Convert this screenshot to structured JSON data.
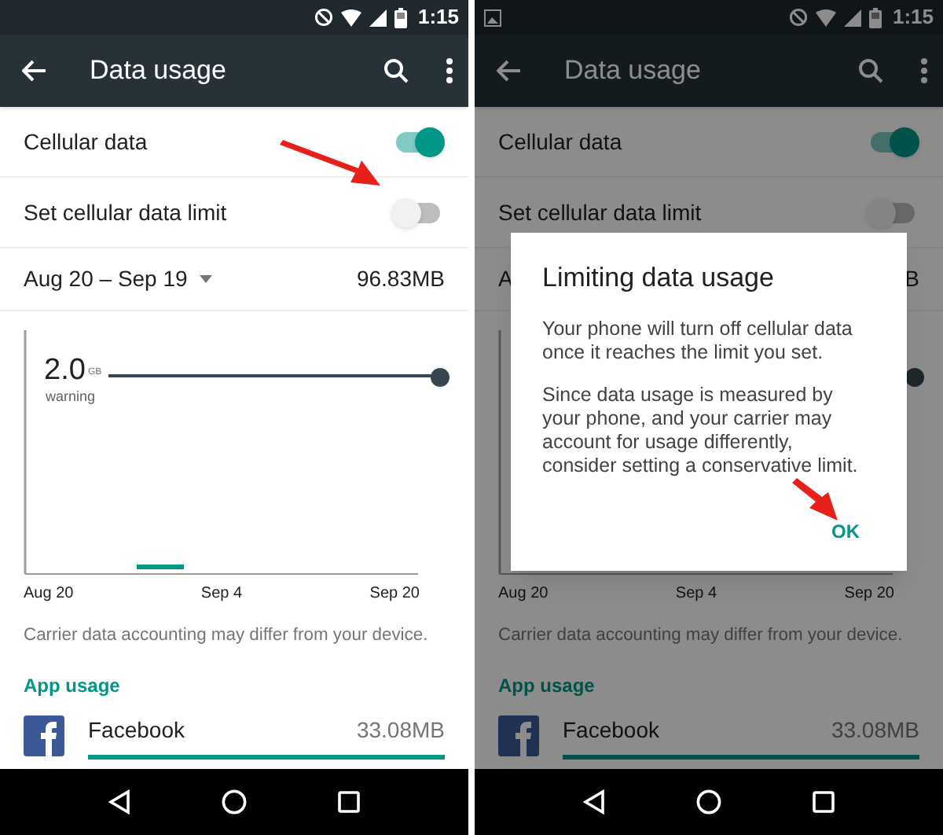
{
  "screens": [
    {
      "status_bar": {
        "time": "1:15"
      },
      "toolbar": {
        "title": "Data usage"
      },
      "settings": [
        {
          "label": "Cellular data",
          "on": true
        },
        {
          "label": "Set cellular data limit",
          "on": false
        }
      ],
      "cycle": {
        "date_range": "Aug 20 – Sep 19",
        "total": "96.83MB"
      },
      "chart": {
        "limit_value": "2.0",
        "limit_unit": "GB",
        "limit_label": "warning",
        "x_labels": [
          "Aug 20",
          "Sep 4",
          "Sep 20"
        ]
      },
      "note": "Carrier data accounting may differ from your device.",
      "app_usage": {
        "header": "App usage",
        "apps": [
          {
            "name": "Facebook",
            "usage": "33.08MB",
            "level": 1
          }
        ]
      },
      "dimmed": false
    },
    {
      "status_bar": {
        "time": "1:15",
        "notification_icons": [
          {
            "kind": "image"
          }
        ]
      },
      "toolbar": {
        "title": "Data usage"
      },
      "settings": [
        {
          "label": "Cellular data",
          "on": true
        },
        {
          "label": "Set cellular data limit",
          "on": false
        }
      ],
      "cycle": {
        "date_range": "A",
        "total": "B"
      },
      "chart": {
        "x_labels": [
          "Aug 20",
          "Sep 4",
          "Sep 20"
        ]
      },
      "note": "Carrier data accounting may differ from your device.",
      "app_usage": {
        "header": "App usage",
        "apps": [
          {
            "name": "Facebook",
            "usage": "33.08MB",
            "level": 1
          }
        ]
      },
      "dimmed": true,
      "dialog": {
        "title": "Limiting data usage",
        "paragraphs": [
          "Your phone will turn off cellular data once it reaches the limit you set.",
          "Since data usage is measured by your phone, and your carrier may account for usage differently, consider setting a conservative limit."
        ],
        "button": "OK"
      }
    }
  ]
}
